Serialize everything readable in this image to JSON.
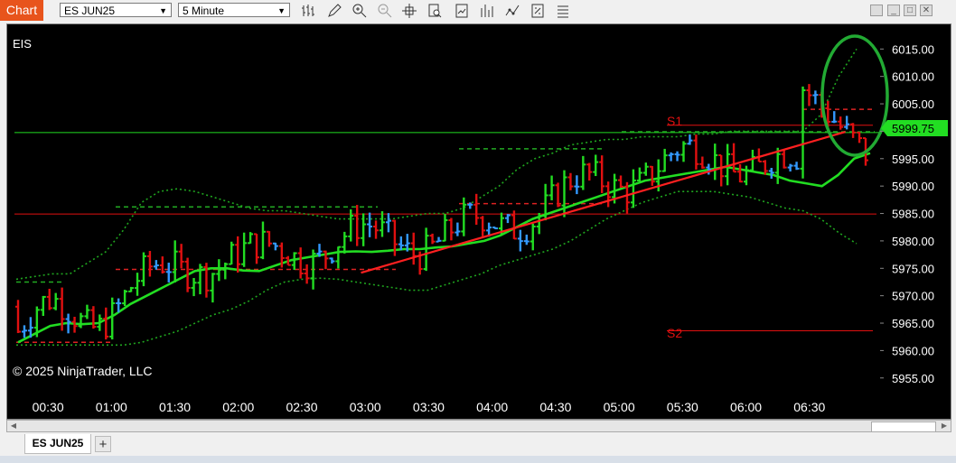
{
  "toolbar": {
    "chart_tab": "Chart",
    "instrument": "ES JUN25",
    "interval": "5 Minute",
    "tools": [
      "bars-type-icon",
      "pencil-icon",
      "zoom-in-icon",
      "zoom-out-icon",
      "crosshair-icon",
      "data-box-icon",
      "chart-style-icon",
      "indicators-icon",
      "strategies-icon",
      "properties-icon"
    ]
  },
  "chart": {
    "symbol_label": "EIS",
    "copyright": "© 2025 NinjaTrader, LLC",
    "current_price": "5999.75",
    "y_ticks": [
      "6015.00",
      "6010.00",
      "6005.00",
      "6000.00",
      "5995.00",
      "5990.00",
      "5985.00",
      "5980.00",
      "5975.00",
      "5970.00",
      "5965.00",
      "5960.00",
      "5955.00"
    ],
    "x_ticks": [
      "00:30",
      "01:00",
      "01:30",
      "02:00",
      "02:30",
      "03:00",
      "03:30",
      "04:00",
      "04:30",
      "05:00",
      "05:30",
      "06:00",
      "06:30"
    ],
    "level_labels": {
      "s1": "S1",
      "s2": "S2"
    },
    "colors": {
      "up": "#22dd22",
      "down": "#e01010",
      "neutral": "#3399ff",
      "ma": "#22dd22",
      "trend": "#ff2020",
      "price_badge": "#22dd22"
    }
  },
  "chart_data": {
    "type": "candlestick",
    "ylim": [
      5952,
      6019
    ],
    "levels": {
      "upper_green": 5999.75,
      "upper_red": 6001.1,
      "lower_red": 5984.9,
      "s2": 5963.6
    },
    "trend_line": {
      "from_time": "02:58",
      "from": 5974.2,
      "to_time": "06:47",
      "to": 5999.9
    },
    "ma": [
      5961.5,
      5963,
      5964.5,
      5965,
      5964.8,
      5965,
      5966.5,
      5968.5,
      5970,
      5971.5,
      5973,
      5974.5,
      5975,
      5975,
      5974.6,
      5974.5,
      5975.5,
      5976.5,
      5977,
      5977.5,
      5978,
      5978.1,
      5978,
      5978.2,
      5978.5,
      5978.5,
      5978.8,
      5979,
      5979.5,
      5980,
      5981,
      5982.5,
      5984,
      5985,
      5986,
      5987,
      5988,
      5989,
      5990,
      5991,
      5991.5,
      5992,
      5992.5,
      5993,
      5993.5,
      5993,
      5992.5,
      5992,
      5991,
      5990.5,
      5990,
      5992,
      5995,
      5996
    ],
    "bands": {
      "upper": [
        5973,
        5973.5,
        5974,
        5974,
        5976,
        5978,
        5982,
        5987,
        5989,
        5989.5,
        5989,
        5988,
        5987,
        5986,
        5985.5,
        5985.5,
        5985,
        5984.5,
        5984,
        5984,
        5984,
        5984,
        5984.5,
        5985,
        5985,
        5986,
        5988,
        5990,
        5993,
        5995,
        5996,
        5997.5,
        5998,
        5998.5,
        5998.5,
        5999,
        5999,
        5999,
        5999.5,
        5999.5,
        6000,
        6000,
        6000,
        6000,
        6000,
        6003,
        6010,
        6015
      ],
      "lower": [
        5961,
        5961,
        5961,
        5961,
        5961,
        5961,
        5961,
        5961.5,
        5962.5,
        5963.5,
        5965,
        5966.5,
        5967.5,
        5969,
        5971,
        5972.5,
        5973,
        5973.2,
        5973,
        5972.5,
        5972,
        5971.5,
        5971,
        5971,
        5972,
        5973,
        5974,
        5975.5,
        5976.5,
        5977.5,
        5978.5,
        5980,
        5982,
        5984,
        5985.5,
        5987,
        5988,
        5989,
        5989,
        5989,
        5988.5,
        5988,
        5987,
        5986,
        5985.5,
        5984,
        5981.5,
        5979.5
      ]
    }
  }
}
